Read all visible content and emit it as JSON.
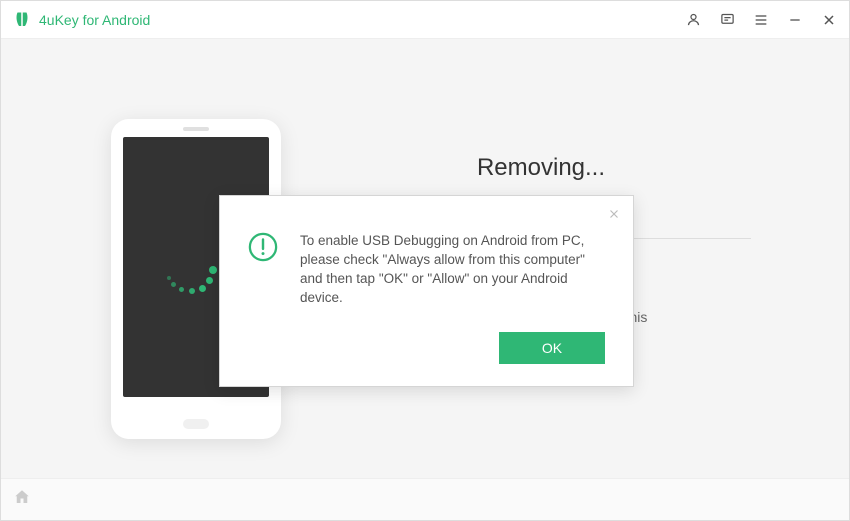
{
  "app": {
    "title": "4uKey for Android"
  },
  "main": {
    "status_title": "Removing...",
    "warning_visible_text": "ice during this"
  },
  "dialog": {
    "message": "To enable USB Debugging on Android from PC, please check \"Always allow from this computer\" and then tap \"OK\" or \"Allow\" on your Android device.",
    "ok_label": "OK"
  },
  "colors": {
    "accent": "#2fb775"
  }
}
